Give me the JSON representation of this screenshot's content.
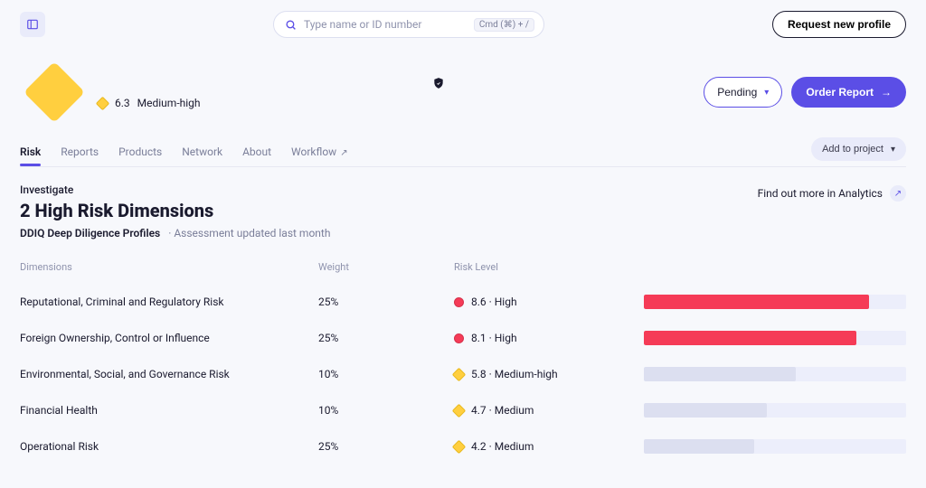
{
  "top": {
    "search_placeholder": "Type name or ID number",
    "search_hint": "Cmd (⌘) + /",
    "request_profile": "Request new profile"
  },
  "header": {
    "score": "6.3",
    "score_label": "Medium-high",
    "pending": "Pending",
    "order": "Order Report"
  },
  "tabs": {
    "risk": "Risk",
    "reports": "Reports",
    "products": "Products",
    "network": "Network",
    "about": "About",
    "workflow": "Workflow",
    "add_project": "Add to project"
  },
  "section": {
    "eyebrow": "Investigate",
    "title": "2 High Risk Dimensions",
    "source": "DDIQ Deep Diligence Profiles",
    "updated": "Assessment updated last month",
    "analytics_link": "Find out more in Analytics"
  },
  "columns": {
    "dim": "Dimensions",
    "weight": "Weight",
    "risk": "Risk Level"
  },
  "rows": [
    {
      "dim": "Reputational, Criminal and Regulatory Risk",
      "weight": "25%",
      "score": "8.6",
      "label": "High",
      "kind": "red",
      "bar_kind": "red",
      "bar_pct": 86
    },
    {
      "dim": "Foreign Ownership, Control or Influence",
      "weight": "25%",
      "score": "8.1",
      "label": "High",
      "kind": "red",
      "bar_kind": "red",
      "bar_pct": 81
    },
    {
      "dim": "Environmental, Social, and Governance Risk",
      "weight": "10%",
      "score": "5.8",
      "label": "Medium-high",
      "kind": "diam",
      "bar_kind": "pale",
      "bar_pct": 58
    },
    {
      "dim": "Financial Health",
      "weight": "10%",
      "score": "4.7",
      "label": "Medium",
      "kind": "diam",
      "bar_kind": "pale",
      "bar_pct": 47
    },
    {
      "dim": "Operational Risk",
      "weight": "25%",
      "score": "4.2",
      "label": "Medium",
      "kind": "diam",
      "bar_kind": "pale",
      "bar_pct": 42
    }
  ],
  "chart_data": {
    "type": "bar",
    "title": "Risk Dimensions",
    "xlabel": "Risk Level",
    "ylabel": "",
    "ylim": [
      0,
      10
    ],
    "categories": [
      "Reputational, Criminal and Regulatory Risk",
      "Foreign Ownership, Control or Influence",
      "Environmental, Social, and Governance Risk",
      "Financial Health",
      "Operational Risk"
    ],
    "values": [
      8.6,
      8.1,
      5.8,
      4.7,
      4.2
    ]
  }
}
